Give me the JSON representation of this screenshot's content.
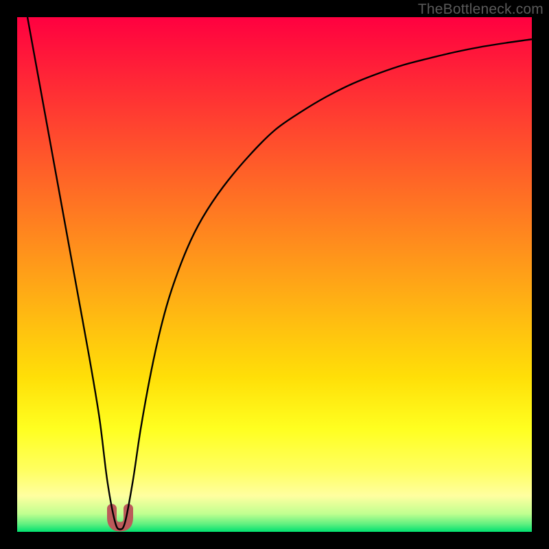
{
  "watermark": "TheBottleneck.com",
  "chart_data": {
    "type": "line",
    "title": "",
    "xlabel": "",
    "ylabel": "",
    "xlim": [
      0,
      100
    ],
    "ylim": [
      0,
      100
    ],
    "grid": false,
    "legend": false,
    "series": [
      {
        "name": "curve",
        "x": [
          2,
          4,
          6,
          8,
          10,
          12,
          14,
          16,
          17.5,
          19,
          20,
          21,
          22.5,
          24,
          26,
          28,
          30,
          33,
          36,
          40,
          45,
          50,
          55,
          60,
          65,
          70,
          75,
          80,
          85,
          90,
          95,
          100
        ],
        "y": [
          100,
          89,
          78,
          67,
          56,
          45,
          34,
          22,
          10,
          2,
          0.5,
          2,
          10,
          20,
          31,
          40,
          47,
          55,
          61,
          67,
          73,
          78,
          81.5,
          84.5,
          87,
          89,
          90.7,
          92,
          93.2,
          94.2,
          95,
          95.7
        ]
      }
    ],
    "marker": {
      "name": "local-minimum",
      "x": 20,
      "y_peak": 4.5,
      "half_width": 1.6,
      "depth": 3.5,
      "color": "#bb5a5a",
      "stroke_width": 14
    },
    "gradient_stops": [
      {
        "offset": 0.0,
        "color": "#ff0040"
      },
      {
        "offset": 0.1,
        "color": "#ff2038"
      },
      {
        "offset": 0.2,
        "color": "#ff4030"
      },
      {
        "offset": 0.3,
        "color": "#ff6028"
      },
      {
        "offset": 0.4,
        "color": "#ff8020"
      },
      {
        "offset": 0.5,
        "color": "#ffa018"
      },
      {
        "offset": 0.6,
        "color": "#ffc010"
      },
      {
        "offset": 0.7,
        "color": "#ffdf08"
      },
      {
        "offset": 0.8,
        "color": "#ffff20"
      },
      {
        "offset": 0.88,
        "color": "#ffff60"
      },
      {
        "offset": 0.93,
        "color": "#ffffa0"
      },
      {
        "offset": 0.965,
        "color": "#c0ff90"
      },
      {
        "offset": 0.985,
        "color": "#60f080"
      },
      {
        "offset": 1.0,
        "color": "#00e070"
      }
    ]
  }
}
